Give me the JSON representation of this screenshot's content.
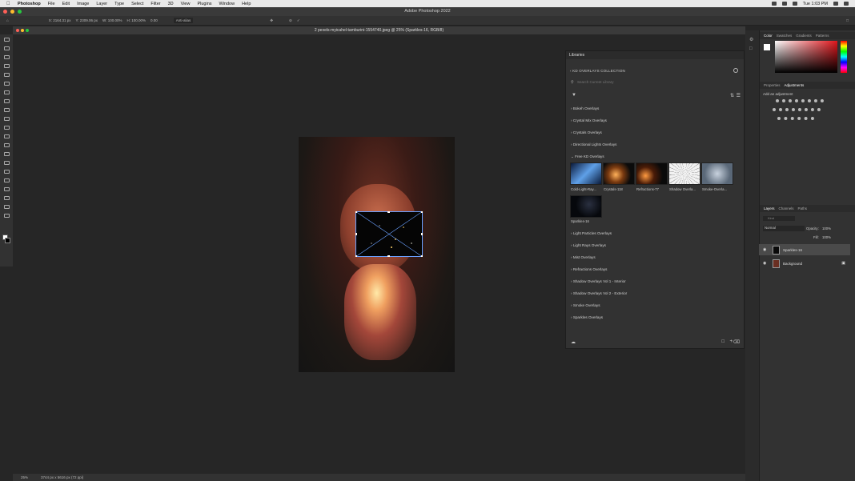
{
  "menubar": {
    "app": "Photoshop",
    "items": [
      "File",
      "Edit",
      "Image",
      "Layer",
      "Type",
      "Select",
      "Filter",
      "3D",
      "View",
      "Plugins",
      "Window",
      "Help"
    ],
    "clock": "Tue 1:03 PM"
  },
  "appbar": {
    "title": "Adobe Photoshop 2022"
  },
  "options": {
    "x": "X: 2164.31 px",
    "y": "Y: 2309.06 px",
    "w": "W: 100.00%",
    "h": "H: 100.00%",
    "angle": "0.00",
    "interp": "Anti-alias"
  },
  "document": {
    "tab_title": "2 pexels-myicahel-tamburini-1554740.jpeg @ 25% (Sparkles-16, RGB/8)"
  },
  "status": {
    "zoom": "25%",
    "size": "3744 px x 5616 px (72 ppi)"
  },
  "libraries": {
    "panel_title": "Libraries",
    "collection": "KD OVERLAYS COLLECTION",
    "search_placeholder": "Search Current Library",
    "sections": [
      "Bokeh Overlays",
      "Crystal Mix Overlays",
      "Crystals Overlays",
      "Directional Lights Overlays",
      "Free KD Overlays"
    ],
    "thumbs": [
      {
        "label": "Cold-Light-Ray...",
        "color": "#2f6db5"
      },
      {
        "label": "Crystals-118",
        "color": "#c86a20"
      },
      {
        "label": "Refractions-77",
        "color": "#b8612a"
      },
      {
        "label": "Shadow Overla...",
        "color": "#e8e8e8"
      },
      {
        "label": "Smoke-Overla...",
        "color": "#8a98a8"
      },
      {
        "label": "Sparkles-16",
        "color": "#06080c"
      }
    ],
    "sections_after": [
      "Light Particles Overlays",
      "Light Rays Overlays",
      "Mist Overlays",
      "Refractions Overlays",
      "Shadow Overlays Vol 1 - Interior",
      "Shadow Overlays Vol 2 - Exterior",
      "Smoke Overlays",
      "Sparkles Overlays"
    ]
  },
  "right": {
    "color_tabs": [
      "Color",
      "Swatches",
      "Gradients",
      "Patterns"
    ],
    "adj_tabs": [
      "Properties",
      "Adjustments"
    ],
    "add_adjustment": "Add an adjustment",
    "layer_tabs": [
      "Layers",
      "Channels",
      "Paths"
    ],
    "blend": "Normal",
    "opacity_label": "Opacity:",
    "opacity": "100%",
    "fill_label": "Fill:",
    "fill": "100%",
    "search": "Kind",
    "layers": [
      "Sparkles-16",
      "Background"
    ],
    "accent": "#e0151b"
  }
}
